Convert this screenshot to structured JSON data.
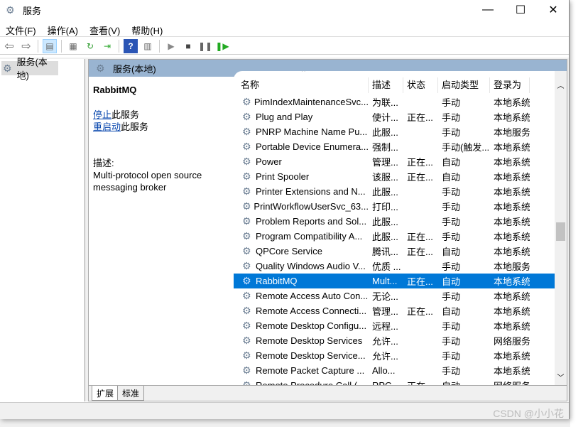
{
  "window": {
    "title": "服务",
    "minimize": "—",
    "maximize": "☐",
    "close": "✕"
  },
  "menu": [
    "文件(F)",
    "操作(A)",
    "查看(V)",
    "帮助(H)"
  ],
  "toolbar": [
    "back",
    "forward",
    "show-hide-tree",
    "properties",
    "refresh",
    "export",
    "help",
    "show-action-pane",
    "start",
    "stop",
    "pause",
    "resume"
  ],
  "tree": {
    "item": "服务(本地)"
  },
  "pane": {
    "title": "服务(本地)"
  },
  "detail": {
    "name": "RabbitMQ",
    "stop_link": "停止",
    "stop_suffix": "此服务",
    "restart_link": "重启动",
    "restart_suffix": "此服务",
    "desc_label": "描述:",
    "desc": "Multi-protocol open source messaging broker"
  },
  "columns": [
    "名称",
    "描述",
    "状态",
    "启动类型",
    "登录为"
  ],
  "rows": [
    [
      "PimIndexMaintenanceSvc...",
      "为联...",
      "",
      "手动",
      "本地系统"
    ],
    [
      "Plug and Play",
      "使计...",
      "正在...",
      "手动",
      "本地系统"
    ],
    [
      "PNRP Machine Name Pu...",
      "此服...",
      "",
      "手动",
      "本地服务"
    ],
    [
      "Portable Device Enumera...",
      "强制...",
      "",
      "手动(触发...",
      "本地系统"
    ],
    [
      "Power",
      "管理...",
      "正在...",
      "自动",
      "本地系统"
    ],
    [
      "Print Spooler",
      "该服...",
      "正在...",
      "自动",
      "本地系统"
    ],
    [
      "Printer Extensions and N...",
      "此服...",
      "",
      "手动",
      "本地系统"
    ],
    [
      "PrintWorkflowUserSvc_63...",
      "打印...",
      "",
      "手动",
      "本地系统"
    ],
    [
      "Problem Reports and Sol...",
      "此服...",
      "",
      "手动",
      "本地系统"
    ],
    [
      "Program Compatibility A...",
      "此服...",
      "正在...",
      "手动",
      "本地系统"
    ],
    [
      "QPCore Service",
      "腾讯...",
      "正在...",
      "自动",
      "本地系统"
    ],
    [
      "Quality Windows Audio V...",
      "优质 ...",
      "",
      "手动",
      "本地服务"
    ],
    [
      "RabbitMQ",
      "Mult...",
      "正在...",
      "自动",
      "本地系统"
    ],
    [
      "Remote Access Auto Con...",
      "无论...",
      "",
      "手动",
      "本地系统"
    ],
    [
      "Remote Access Connecti...",
      "管理...",
      "正在...",
      "自动",
      "本地系统"
    ],
    [
      "Remote Desktop Configu...",
      "远程...",
      "",
      "手动",
      "本地系统"
    ],
    [
      "Remote Desktop Services",
      "允许...",
      "",
      "手动",
      "网络服务"
    ],
    [
      "Remote Desktop Service...",
      "允许...",
      "",
      "手动",
      "本地系统"
    ],
    [
      "Remote Packet Capture ...",
      "Allo...",
      "",
      "手动",
      "本地系统"
    ],
    [
      "Remote Procedure Call (...",
      "RPC...",
      "正在...",
      "自动",
      "网络服务"
    ]
  ],
  "selected_row": "RabbitMQ",
  "tabs": [
    "扩展",
    "标准"
  ],
  "watermark": "CSDN @小小花",
  "colors": {
    "selection": "#0078d7",
    "pane_header": "#99b4d1"
  }
}
